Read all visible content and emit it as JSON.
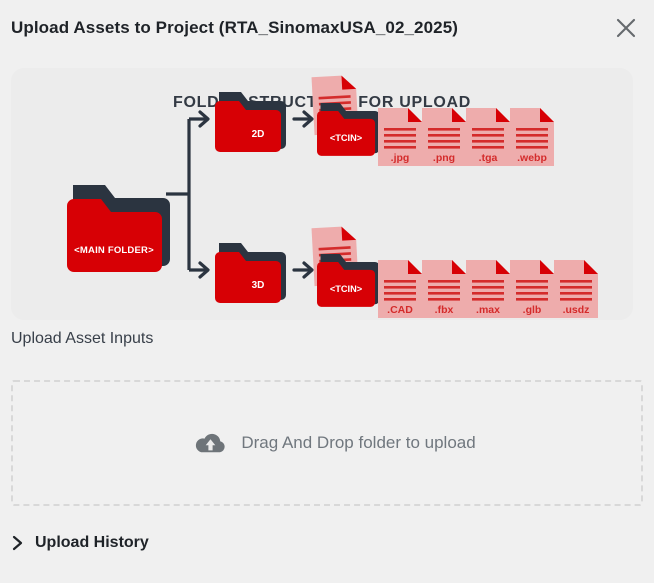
{
  "header": {
    "title": "Upload Assets to Project (RTA_SinomaxUSA_02_2025)",
    "close_label": "close-icon"
  },
  "diagram": {
    "title": "FOLDER STRUCTURE FOR UPLOAD",
    "main_folder_label": "<MAIN FOLDER>",
    "rows": [
      {
        "folder_label": "2D",
        "tcin_label": "<TCIN>",
        "files": [
          ".jpg",
          ".png",
          ".tga",
          ".webp"
        ]
      },
      {
        "folder_label": "3D",
        "tcin_label": "<TCIN>",
        "files": [
          ".CAD",
          ".fbx",
          ".max",
          ".glb",
          ".usdz"
        ]
      }
    ],
    "colors": {
      "folder_red": "#d70005",
      "folder_dark": "#2b3440",
      "file_pink": "#eeacac",
      "file_line_red": "#d42b2b",
      "arrow_dark": "#2b3440",
      "panel_bg": "#ececec",
      "title_color": "#333a44"
    }
  },
  "section": {
    "label": "Upload Asset Inputs"
  },
  "dropzone": {
    "text": "Drag And Drop folder to upload",
    "icon": "cloud-upload-icon"
  },
  "upload_history": {
    "label": "Upload History",
    "icon": "chevron-right-icon"
  }
}
